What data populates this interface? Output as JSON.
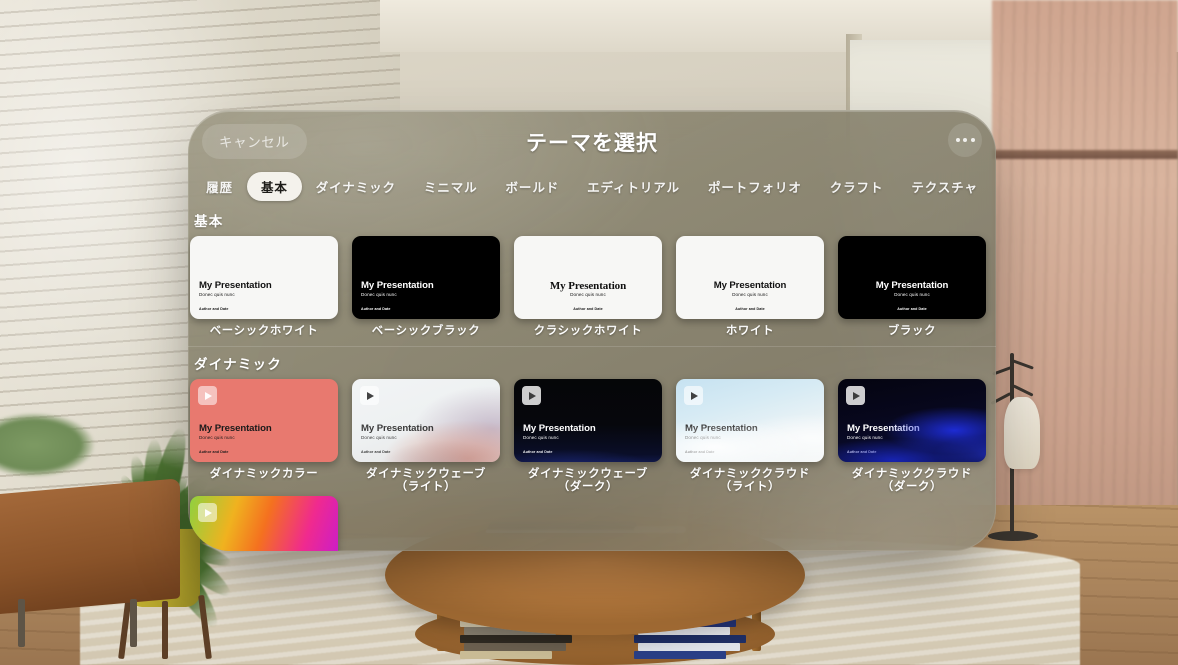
{
  "window": {
    "title": "テーマを選択",
    "cancel_label": "キャンセル",
    "more_icon": "ellipsis-icon"
  },
  "tabs": [
    {
      "label": "履歴",
      "active": false
    },
    {
      "label": "基本",
      "active": true
    },
    {
      "label": "ダイナミック",
      "active": false
    },
    {
      "label": "ミニマル",
      "active": false
    },
    {
      "label": "ボールド",
      "active": false
    },
    {
      "label": "エディトリアル",
      "active": false
    },
    {
      "label": "ポートフォリオ",
      "active": false
    },
    {
      "label": "クラフト",
      "active": false
    },
    {
      "label": "テクスチャ",
      "active": false
    }
  ],
  "slide_text": {
    "title": "My Presentation",
    "subtitle": "Donec quis nunc",
    "footer": "Author and Date",
    "title_upper": "MY PRESENTATION"
  },
  "sections": [
    {
      "heading": "基本",
      "themes": [
        {
          "label": "ベーシックホワイト",
          "skin": "sk-white",
          "align": "left",
          "font": "sans",
          "animated": false
        },
        {
          "label": "ベーシックブラック",
          "skin": "sk-black",
          "align": "left",
          "font": "sans",
          "animated": false
        },
        {
          "label": "クラシックホワイト",
          "skin": "sk-white",
          "align": "center",
          "font": "serif",
          "animated": false
        },
        {
          "label": "ホワイト",
          "skin": "sk-white",
          "align": "center",
          "font": "sans",
          "animated": false
        },
        {
          "label": "ブラック",
          "skin": "sk-black",
          "align": "center",
          "font": "sans",
          "animated": false
        }
      ]
    },
    {
      "heading": "ダイナミック",
      "themes": [
        {
          "label": "ダイナミックカラー",
          "skin": "sk-coral",
          "align": "left",
          "font": "sans",
          "animated": true,
          "chip": "on-color"
        },
        {
          "label": "ダイナミックウェーブ\n（ライト）",
          "skin": "sk-wavelight",
          "align": "left",
          "font": "sans",
          "animated": true,
          "chip": "light-chip"
        },
        {
          "label": "ダイナミックウェーブ\n（ダーク）",
          "skin": "sk-wavedark",
          "align": "left",
          "font": "sans",
          "animated": true,
          "chip": "dark-chip"
        },
        {
          "label": "ダイナミッククラウド\n（ライト）",
          "skin": "sk-cloudlight",
          "align": "left",
          "font": "sans",
          "animated": true,
          "chip": "light-chip"
        },
        {
          "label": "ダイナミッククラウド\n（ダーク）",
          "skin": "sk-clouddark",
          "align": "left",
          "font": "sans",
          "animated": true,
          "chip": "dark-chip"
        },
        {
          "label": "",
          "skin": "sk-neon",
          "align": "left",
          "font": "sans",
          "animated": true,
          "chip": "on-color",
          "partial": true
        }
      ]
    }
  ],
  "colors": {
    "panel_tint": "#8a836d",
    "active_tab_bg": "#f4f2ec",
    "text_primary": "#ffffff",
    "coral": "#e8796f",
    "neon_start": "#8fd13f",
    "neon_end": "#c41ad4"
  }
}
